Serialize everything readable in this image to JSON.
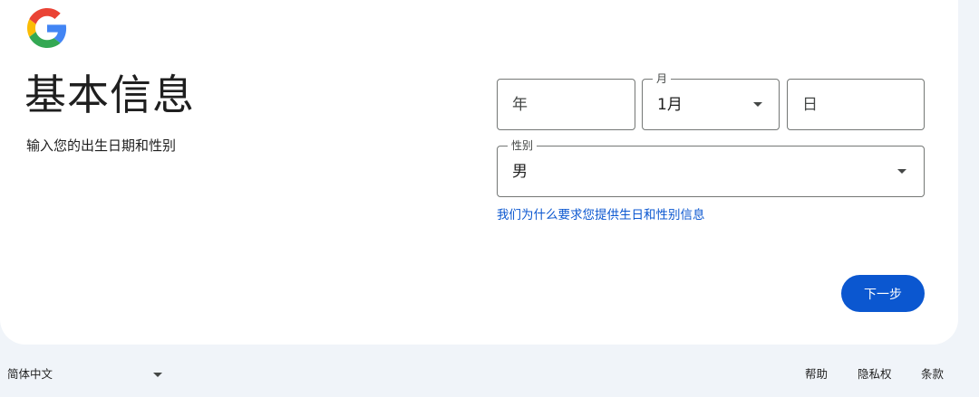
{
  "header": {
    "title": "基本信息",
    "subtitle": "输入您的出生日期和性别"
  },
  "form": {
    "year": {
      "placeholder": "年"
    },
    "month": {
      "label": "月",
      "value": "1月"
    },
    "day": {
      "placeholder": "日"
    },
    "gender": {
      "label": "性别",
      "value": "男"
    },
    "why_link": "我们为什么要求您提供生日和性别信息",
    "next_label": "下一步"
  },
  "footer": {
    "language": "简体中文",
    "links": [
      "帮助",
      "隐私权",
      "条款"
    ]
  },
  "colors": {
    "accent": "#0b57d0",
    "page_bg": "#f0f4f9",
    "card_bg": "#ffffff",
    "outline": "#747775"
  },
  "icons": {
    "logo": "google-g-icon",
    "dropdown": "caret-down-icon"
  }
}
